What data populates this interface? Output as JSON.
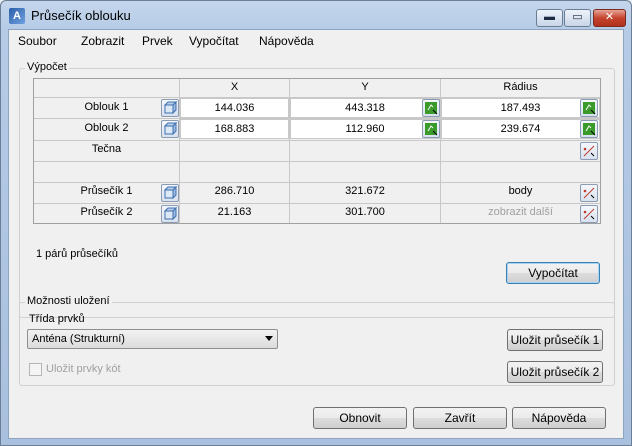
{
  "window": {
    "title": "Průsečík oblouku",
    "min_glyph": "▬",
    "max_glyph": "▭",
    "close_glyph": "✕"
  },
  "menu": [
    "Soubor",
    "Zobrazit",
    "Prvek",
    "Vypočítat",
    "Nápověda"
  ],
  "calc_group": {
    "legend": "Výpočet",
    "headers": [
      "X",
      "Y",
      "Rádius"
    ],
    "rows": {
      "arc1": {
        "label": "Oblouk 1",
        "x": "144.036",
        "y": "443.318",
        "radius": "187.493"
      },
      "arc2": {
        "label": "Oblouk 2",
        "x": "168.883",
        "y": "112.960",
        "radius": "239.674"
      },
      "tangent": {
        "label": "Tečna"
      },
      "int1": {
        "label": "Průsečík 1",
        "x": "286.710",
        "y": "321.672",
        "radius": "body"
      },
      "int2": {
        "label": "Průsečík 2",
        "x": "21.163",
        "y": "301.700",
        "radius": "zobrazit další"
      }
    },
    "status": "1 párů průsečíků",
    "calculate_button": "Vypočítat"
  },
  "save_group": {
    "legend": "Možnosti uložení",
    "class_label": "Třída prvků",
    "class_value": "Anténa (Strukturní)",
    "save_dims_label": "Uložit prvky kót",
    "save_int1_button": "Uložit průsečík 1",
    "save_int2_button": "Uložit průsečík 2"
  },
  "footer": {
    "reset_button": "Obnovit",
    "close_button": "Zavřít",
    "help_button": "Nápověda"
  },
  "icons": {
    "app": "autocad-icon",
    "select_arc": "select-object-icon",
    "pick_point": "pick-point-icon",
    "measure": "measure-icon"
  },
  "colors": {
    "accent_green": "#3a9a2a",
    "default_button_border": "#3c7fb1"
  }
}
